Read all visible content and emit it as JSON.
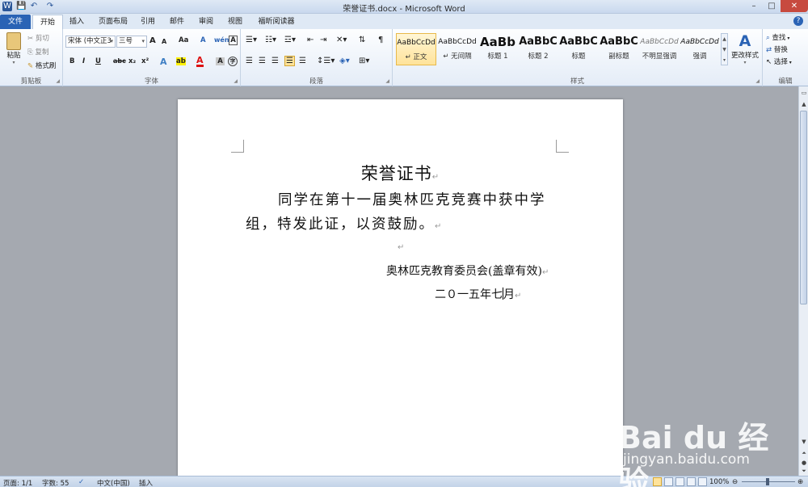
{
  "window": {
    "title": "荣誉证书.docx - Microsoft Word",
    "controls": [
      "–",
      "□",
      "✕"
    ]
  },
  "quick_access": [
    "W",
    "💾",
    "↶",
    "↷"
  ],
  "tabs": [
    "文件",
    "开始",
    "插入",
    "页面布局",
    "引用",
    "邮件",
    "审阅",
    "视图",
    "福昕阅读器"
  ],
  "active_tab": "开始",
  "ribbon": {
    "clipboard": {
      "label": "剪贴板",
      "paste": "粘贴",
      "cut": "剪切",
      "copy": "复制",
      "format_painter": "格式刷"
    },
    "font": {
      "label": "字体",
      "font_name": "宋体 (中文正3",
      "font_size": "三号",
      "bold": "B",
      "italic": "I",
      "underline": "U",
      "strike": "abc",
      "subscript": "x₂",
      "superscript": "x²",
      "grow": "A",
      "shrink": "A",
      "change_case": "Aa",
      "clear": "A",
      "phonetic": "wén",
      "border_char": "A",
      "font_color": "A",
      "highlight": "ab",
      "shade": "A",
      "enclose": "字"
    },
    "paragraph": {
      "label": "段落"
    },
    "styles": {
      "label": "样式",
      "items": [
        {
          "preview": "AaBbCcDd",
          "name": "↵ 正文"
        },
        {
          "preview": "AaBbCcDd",
          "name": "↵ 无间隔"
        },
        {
          "preview": "AaBb",
          "name": "标题 1"
        },
        {
          "preview": "AaBbC",
          "name": "标题 2"
        },
        {
          "preview": "AaBbC",
          "name": "标题"
        },
        {
          "preview": "AaBbC",
          "name": "副标题"
        },
        {
          "preview": "AaBbCcDd",
          "name": "不明显强调"
        },
        {
          "preview": "AaBbCcDd",
          "name": "强调"
        }
      ],
      "change_styles": "更改样式"
    },
    "editing": {
      "label": "编辑",
      "find": "查找",
      "replace": "替换",
      "select": "选择"
    }
  },
  "document": {
    "title": "荣誉证书",
    "body": "同学在第十一届奥林匹克竞赛中获中学组，特发此证，以资鼓励。",
    "signer": "奥林匹克教育委员会(盖章有效)",
    "date_before_caret": "二０一五年七",
    "date_after_caret": "月",
    "para_mark": "↵"
  },
  "status": {
    "page": "页面: 1/1",
    "words": "字数: 55",
    "language": "中文(中国)",
    "mode": "插入",
    "zoom": "100%"
  },
  "watermark": {
    "brand": "Bai du 经验",
    "url": "jingyan.baidu.com"
  }
}
